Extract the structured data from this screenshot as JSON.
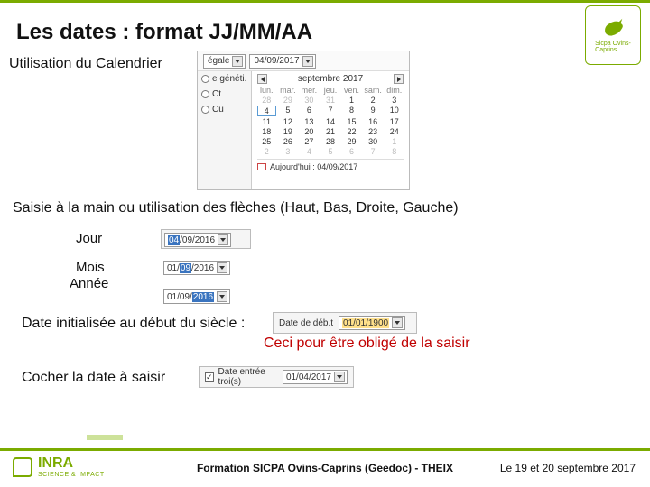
{
  "title": "Les dates : format JJ/MM/AA",
  "badge": {
    "line1": "Sicpa Ovins-",
    "line2": "Caprins"
  },
  "labels": {
    "utilisation": "Utilisation du Calendrier",
    "saisie": "Saisie à la main ou utilisation des flèches (Haut, Bas, Droite, Gauche)",
    "jour": "Jour",
    "mois": "Mois",
    "annee": "Année",
    "init": "Date initialisée au début du siècle :",
    "ceci": "Ceci pour être obligé de la saisir",
    "cocher": "Cocher la date à saisir"
  },
  "calendar": {
    "combo_label": "égale",
    "top_date": "04/09/2017",
    "left_opts": [
      "e généti.",
      "Ct",
      "Cu"
    ],
    "month_label": "septembre 2017",
    "day_headers": [
      "lun.",
      "mar.",
      "mer.",
      "jeu.",
      "ven.",
      "sam.",
      "dim."
    ],
    "weeks": [
      [
        {
          "d": "28",
          "o": true
        },
        {
          "d": "29",
          "o": true
        },
        {
          "d": "30",
          "o": true
        },
        {
          "d": "31",
          "o": true
        },
        {
          "d": "1"
        },
        {
          "d": "2"
        },
        {
          "d": "3"
        }
      ],
      [
        {
          "d": "4",
          "sel": true
        },
        {
          "d": "5"
        },
        {
          "d": "6"
        },
        {
          "d": "7"
        },
        {
          "d": "8"
        },
        {
          "d": "9"
        },
        {
          "d": "10"
        }
      ],
      [
        {
          "d": "11"
        },
        {
          "d": "12"
        },
        {
          "d": "13"
        },
        {
          "d": "14"
        },
        {
          "d": "15"
        },
        {
          "d": "16"
        },
        {
          "d": "17"
        }
      ],
      [
        {
          "d": "18"
        },
        {
          "d": "19"
        },
        {
          "d": "20"
        },
        {
          "d": "21"
        },
        {
          "d": "22"
        },
        {
          "d": "23"
        },
        {
          "d": "24"
        }
      ],
      [
        {
          "d": "25"
        },
        {
          "d": "26"
        },
        {
          "d": "27"
        },
        {
          "d": "28"
        },
        {
          "d": "29"
        },
        {
          "d": "30"
        },
        {
          "d": "1",
          "o": true
        }
      ],
      [
        {
          "d": "2",
          "o": true
        },
        {
          "d": "3",
          "o": true
        },
        {
          "d": "4",
          "o": true
        },
        {
          "d": "5",
          "o": true
        },
        {
          "d": "6",
          "o": true
        },
        {
          "d": "7",
          "o": true
        },
        {
          "d": "8",
          "o": true
        }
      ]
    ],
    "today_label": "Aujourd'hui : 04/09/2017"
  },
  "date_fields": {
    "jour": {
      "sel": "04",
      "rest": "/09/2016"
    },
    "mois": {
      "pre": "01/",
      "sel": "09",
      "post": "/2016"
    },
    "annee": {
      "pre": "01/09/",
      "sel": "2016"
    }
  },
  "init_field": {
    "label": "Date de déb.t",
    "value": "01/01/1900"
  },
  "cocher_field": {
    "label": "Date entrée troi(s)",
    "value": "01/04/2017"
  },
  "footer": {
    "inra": "INRA",
    "inra_sub": "SCIENCE & IMPACT",
    "center": "Formation SICPA Ovins-Caprins (Geedoc) - THEIX",
    "right": "Le 19 et 20 septembre 2017"
  }
}
